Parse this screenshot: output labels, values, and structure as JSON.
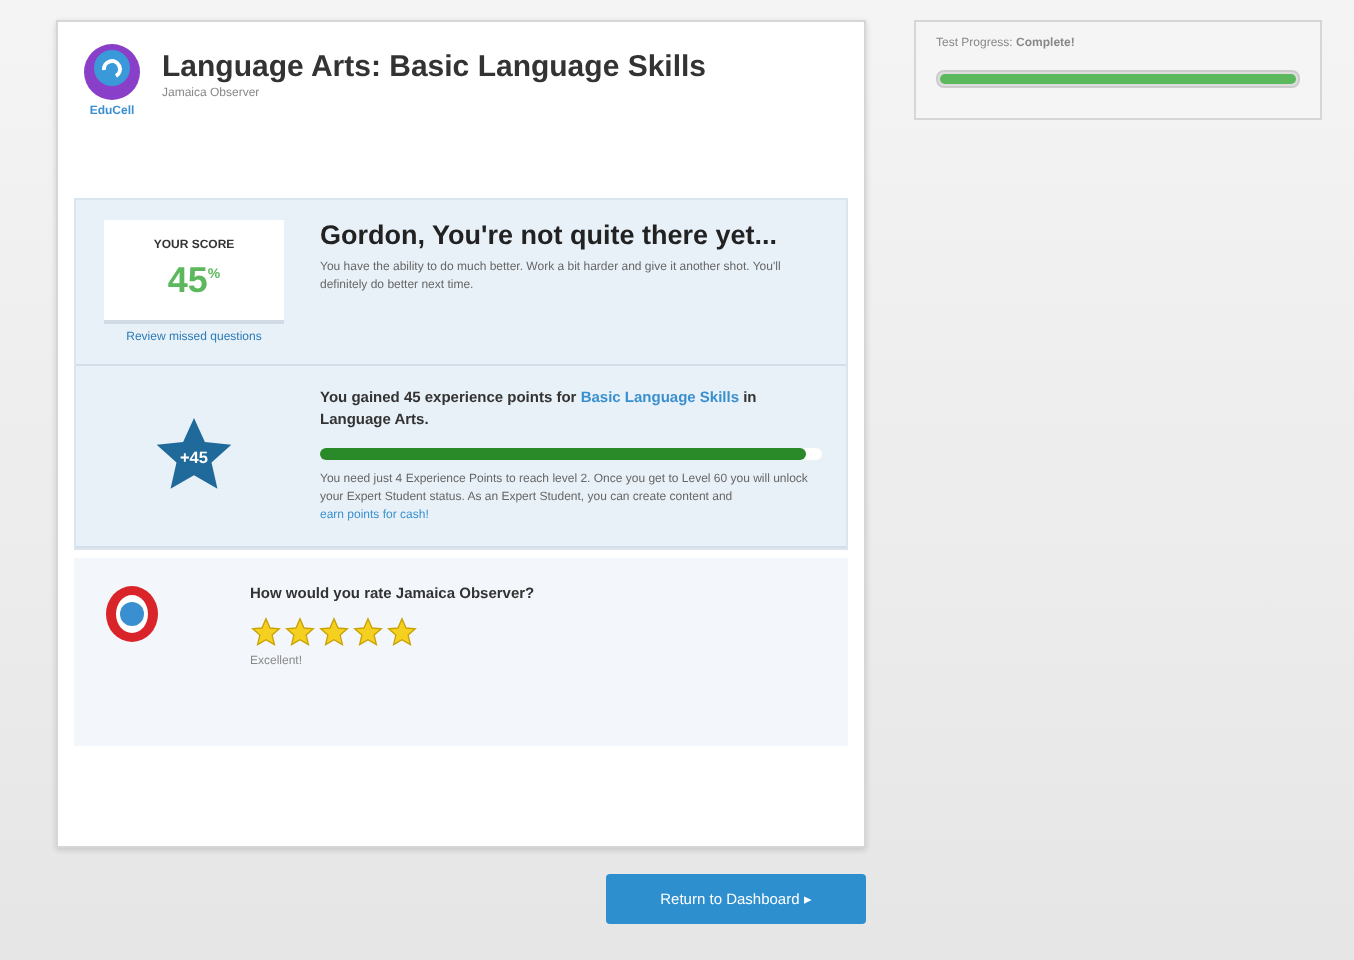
{
  "header": {
    "title": "Language Arts: Basic Language Skills",
    "subtitle": "Jamaica Observer",
    "logo_label": "EduCell"
  },
  "progress": {
    "label": "Test Progress:",
    "value": "Complete!",
    "level": 1
  },
  "score": {
    "label": "YOUR SCORE",
    "value": "45",
    "unit": "%",
    "review_link": "Review missed questions"
  },
  "feedback": {
    "heading": "Gordon, You're not quite there yet...",
    "body": "You have the ability to do much better. Work a bit harder and give it another shot. You'll definitely do better next time."
  },
  "experience": {
    "badge": "+45",
    "before": "You gained 45 experience points for ",
    "link": "Basic Language Skills",
    "after": " in Language Arts.",
    "level": 0.97,
    "note": "You need just 4 Experience Points to reach level 2. Once you get to Level 60 you will unlock your Expert Student status. As an Expert Student, you can create content and ",
    "note_link": "earn points for cash!"
  },
  "rating": {
    "question": "How would you rate Jamaica Observer?",
    "stars": 5,
    "verdict": "Excellent!"
  },
  "button": {
    "label": "Return to Dashboard",
    "arrow": "▸"
  }
}
